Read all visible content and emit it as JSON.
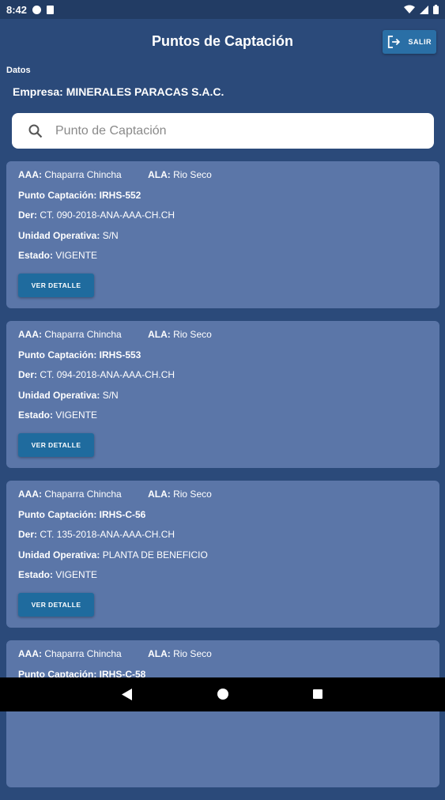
{
  "status_bar": {
    "time": "8:42"
  },
  "header": {
    "title": "Puntos de Captación",
    "logout_label": "SALIR"
  },
  "datos": {
    "section_label": "Datos",
    "empresa_label": "Empresa:",
    "empresa_value": "MINERALES PARACAS S.A.C."
  },
  "search": {
    "placeholder": "Punto de Captación"
  },
  "labels": {
    "aaa": "AAA:",
    "ala": "ALA:",
    "punto": "Punto Captación:",
    "der": "Der:",
    "unidad": "Unidad Operativa:",
    "estado": "Estado:",
    "detail_button": "VER DETALLE"
  },
  "points": [
    {
      "aaa": "Chaparra Chincha",
      "ala": "Rio Seco",
      "punto": "IRHS-552",
      "der": "CT. 090-2018-ANA-AAA-CH.CH",
      "unidad": "S/N",
      "estado": "VIGENTE"
    },
    {
      "aaa": "Chaparra Chincha",
      "ala": "Rio Seco",
      "punto": "IRHS-553",
      "der": "CT. 094-2018-ANA-AAA-CH.CH",
      "unidad": "S/N",
      "estado": "VIGENTE"
    },
    {
      "aaa": "Chaparra Chincha",
      "ala": "Rio Seco",
      "punto": "IRHS-C-56",
      "der": "CT. 135-2018-ANA-AAA-CH.CH",
      "unidad": "PLANTA DE BENEFICIO",
      "estado": "VIGENTE"
    },
    {
      "aaa": "Chaparra Chincha",
      "ala": "Rio Seco",
      "punto": "IRHS-C-58",
      "der": "",
      "unidad": "",
      "estado": ""
    }
  ],
  "colors": {
    "background": "#2b4a7a",
    "card": "#5b76a8",
    "button": "#1f6b9e",
    "search_bg": "#ffffff"
  },
  "icons": {
    "search": "search-icon",
    "logout": "logout-icon",
    "wifi": "wifi-icon",
    "battery": "battery-icon"
  }
}
